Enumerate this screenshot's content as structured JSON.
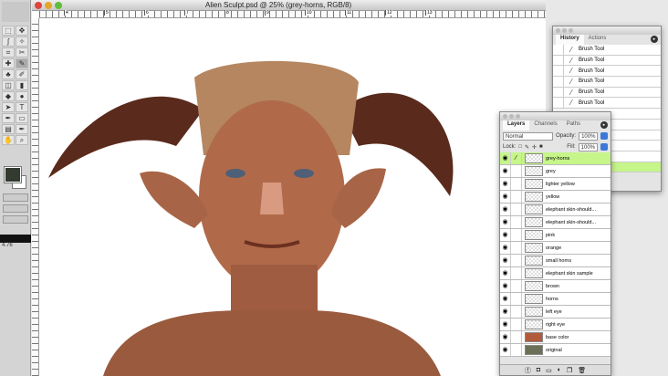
{
  "document": {
    "title": "Alien Sculpt.psd @ 25% (grey-horns, RGB/8)",
    "ruler_marks": [
      "4",
      "5",
      "6",
      "7",
      "8",
      "9",
      "10",
      "11",
      "12",
      "13"
    ]
  },
  "toolbar": {
    "tools": [
      "marquee",
      "move",
      "lasso",
      "magic-wand",
      "crop",
      "slice",
      "healing",
      "brush",
      "stamp",
      "history-brush",
      "eraser",
      "gradient",
      "blur",
      "dodge",
      "path-select",
      "type",
      "pen",
      "shape",
      "notes",
      "eyedropper",
      "hand",
      "zoom"
    ],
    "foreground_color": "#333a30",
    "background_color": "#ffffff",
    "zoom_readout": "4.76"
  },
  "history": {
    "tabs": [
      "History",
      "Actions"
    ],
    "items": [
      "Brush Tool",
      "Brush Tool",
      "Brush Tool",
      "Brush Tool",
      "Brush Tool",
      "Brush Tool"
    ]
  },
  "layers": {
    "tabs": [
      "Layers",
      "Channels",
      "Paths"
    ],
    "blend_mode": "Normal",
    "opacity_label": "Opacity:",
    "opacity": "100%",
    "lock_label": "Lock:",
    "fill_label": "Fill:",
    "fill": "100%",
    "items": [
      "grey-horns",
      "grey",
      "lighter yellow",
      "yellow",
      "elephant skin-should...",
      "elephant skin-should...",
      "pink",
      "orange",
      "small horns",
      "elephant skin sample",
      "brown",
      "horns",
      "left eye",
      "right eye",
      "base color",
      "original"
    ],
    "active_color": "#c6f58a"
  }
}
